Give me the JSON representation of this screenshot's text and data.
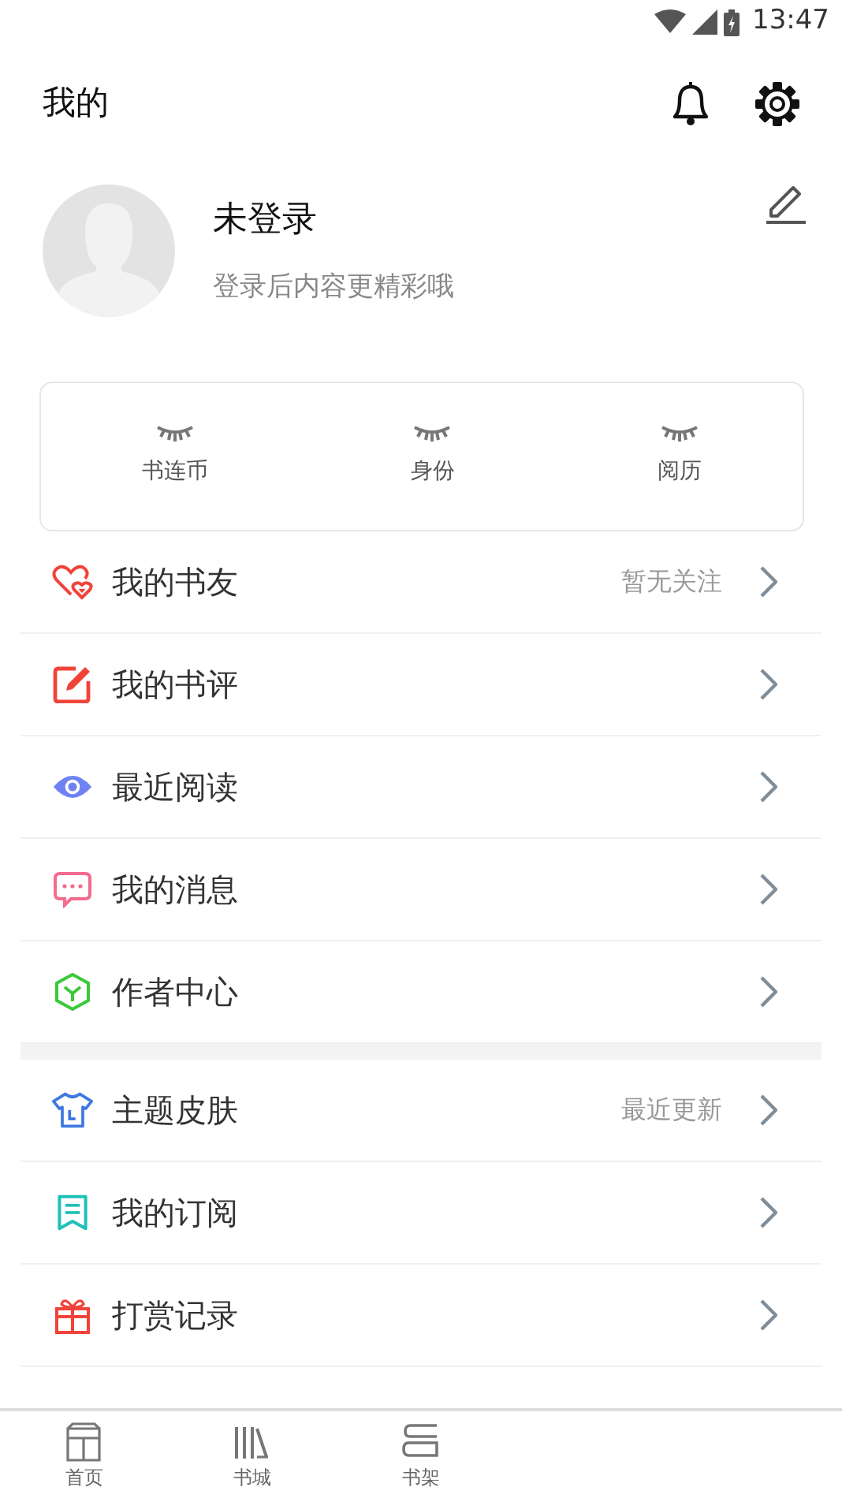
{
  "status_bar": {
    "time": "13:47"
  },
  "header": {
    "title": "我的"
  },
  "profile": {
    "name": "未登录",
    "hint": "登录后内容更精彩哦"
  },
  "stats": [
    {
      "label": "书连币"
    },
    {
      "label": "身份"
    },
    {
      "label": "阅历"
    }
  ],
  "menu_groups": [
    {
      "items": [
        {
          "kind": "friends",
          "label": "我的书友",
          "note": "暂无关注"
        },
        {
          "kind": "review",
          "label": "我的书评"
        },
        {
          "kind": "history",
          "label": "最近阅读"
        },
        {
          "kind": "message",
          "label": "我的消息"
        },
        {
          "kind": "author",
          "label": "作者中心"
        }
      ]
    },
    {
      "items": [
        {
          "kind": "theme",
          "label": "主题皮肤",
          "note": "最近更新"
        },
        {
          "kind": "subscription",
          "label": "我的订阅"
        },
        {
          "kind": "reward",
          "label": "打赏记录"
        }
      ]
    }
  ],
  "bottom_nav": [
    {
      "kind": "home",
      "label": "首页"
    },
    {
      "kind": "store",
      "label": "书城"
    },
    {
      "kind": "shelf",
      "label": "书架"
    }
  ]
}
